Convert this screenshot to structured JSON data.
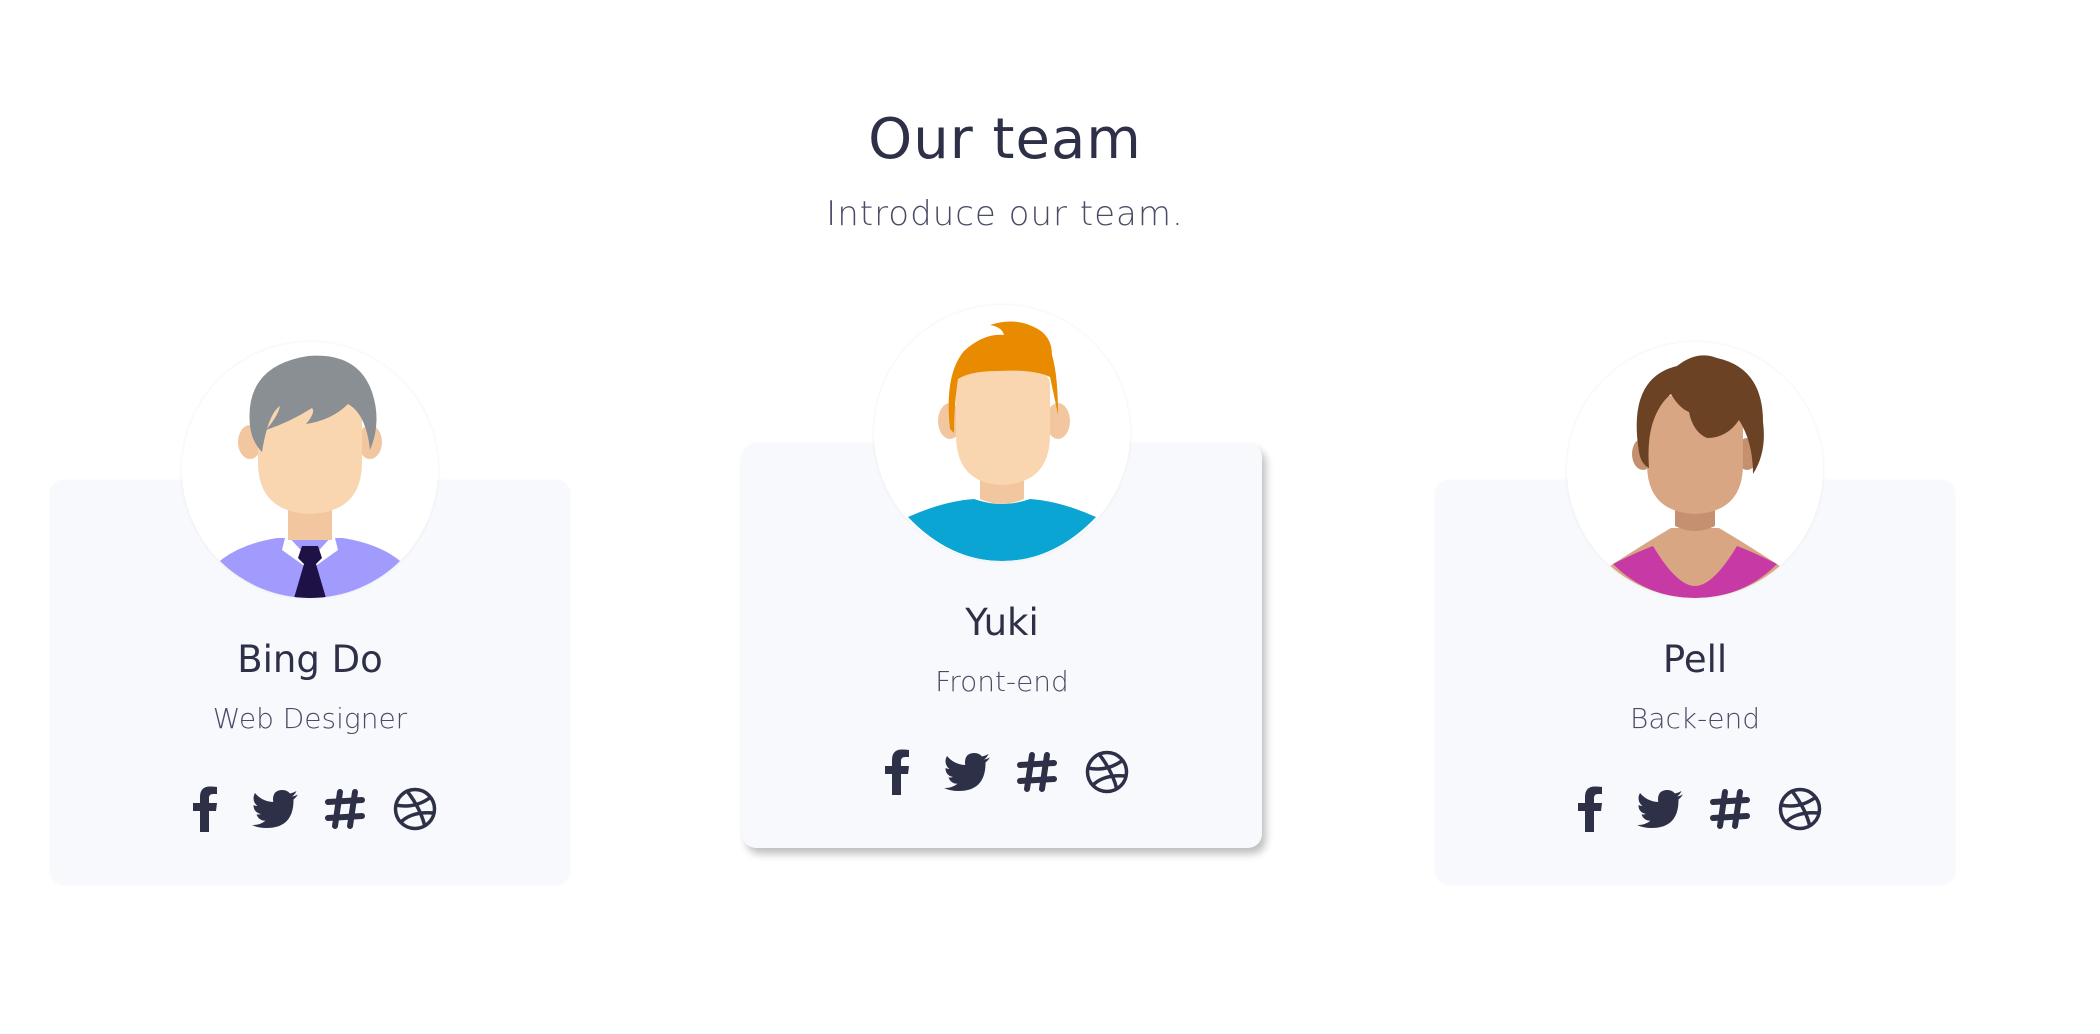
{
  "section": {
    "title": "Our team",
    "subtitle": "Introduce our team."
  },
  "members": [
    {
      "name": "Bing Do",
      "role": "Web Designer"
    },
    {
      "name": "Yuki",
      "role": "Front-end"
    },
    {
      "name": "Pell",
      "role": "Back-end"
    }
  ],
  "social_icons": [
    "facebook-icon",
    "twitter-icon",
    "slack-icon",
    "dribbble-icon"
  ],
  "colors": {
    "text": "#2e3047",
    "card_bg": "#f7f9fc",
    "icon": "#2e3047"
  }
}
